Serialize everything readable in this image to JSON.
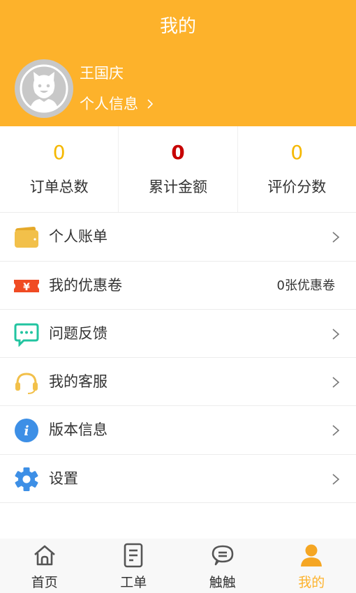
{
  "header": {
    "title": "我的",
    "user_name": "王国庆",
    "profile_link": "个人信息",
    "bg_color": "#fdb22b"
  },
  "stats": [
    {
      "value": "0",
      "label": "订单总数",
      "color": "#f5b800"
    },
    {
      "value": "0",
      "label": "累计金额",
      "color": "#c70000"
    },
    {
      "value": "0",
      "label": "评价分数",
      "color": "#f5b800"
    }
  ],
  "menu": [
    {
      "icon": "wallet-icon",
      "label": "个人账单",
      "right": "",
      "chevron": true
    },
    {
      "icon": "coupon-icon",
      "label": "我的优惠卷",
      "right": "0张优惠卷",
      "chevron": false
    },
    {
      "icon": "feedback-icon",
      "label": "问题反馈",
      "right": "",
      "chevron": true
    },
    {
      "icon": "headset-icon",
      "label": "我的客服",
      "right": "",
      "chevron": true
    },
    {
      "icon": "info-icon",
      "label": "版本信息",
      "right": "",
      "chevron": true
    },
    {
      "icon": "gear-icon",
      "label": "设置",
      "right": "",
      "chevron": true
    }
  ],
  "tabbar": [
    {
      "icon": "home-icon",
      "label": "首页",
      "active": false
    },
    {
      "icon": "work-order-icon",
      "label": "工单",
      "active": false
    },
    {
      "icon": "chat-icon",
      "label": "触触",
      "active": false
    },
    {
      "icon": "user-icon",
      "label": "我的",
      "active": true
    }
  ]
}
